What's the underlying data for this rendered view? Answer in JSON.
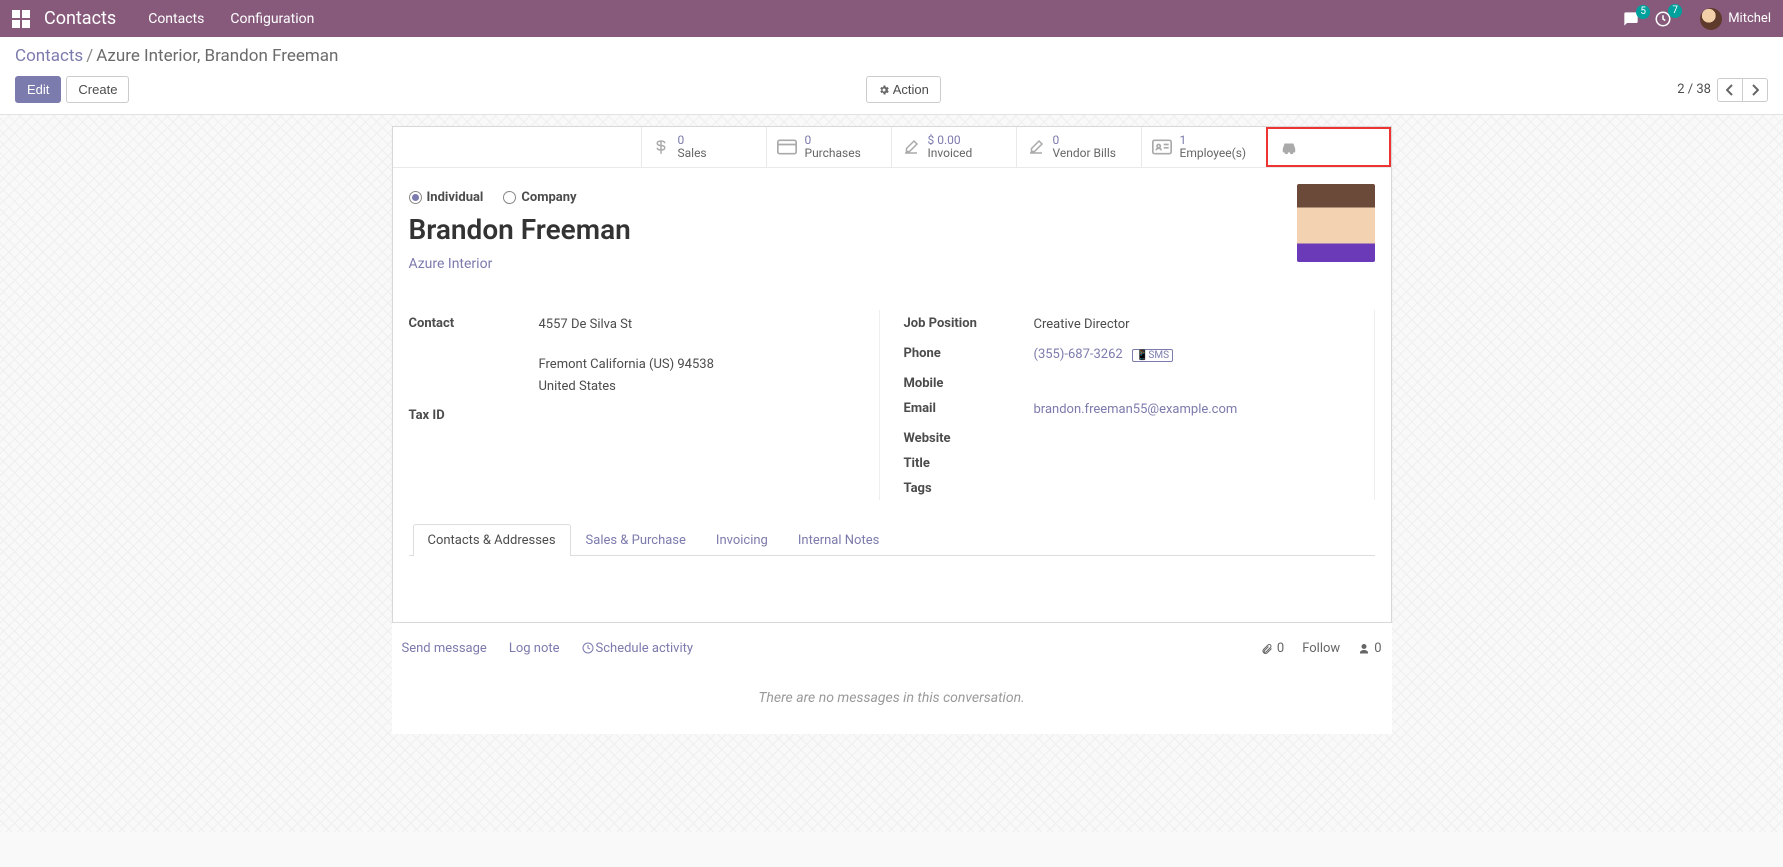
{
  "navbar": {
    "brand": "Contacts",
    "links": [
      "Contacts",
      "Configuration"
    ],
    "chat_badge": "5",
    "activity_badge": "7",
    "user_name": "Mitchel"
  },
  "breadcrumb": {
    "root": "Contacts",
    "active": "Azure Interior, Brandon Freeman"
  },
  "buttons": {
    "edit": "Edit",
    "create": "Create",
    "action": "Action"
  },
  "pager": {
    "current": "2",
    "sep": "/",
    "total": "38"
  },
  "stats": {
    "sales": {
      "value": "0",
      "label": "Sales"
    },
    "purchases": {
      "value": "0",
      "label": "Purchases"
    },
    "invoiced": {
      "value": "$ 0.00",
      "label": "Invoiced"
    },
    "vendor": {
      "value": "0",
      "label": "Vendor Bills"
    },
    "employees": {
      "value": "1",
      "label": "Employee(s)"
    }
  },
  "contact_type": {
    "individual": "Individual",
    "company": "Company"
  },
  "record": {
    "name": "Brandon Freeman",
    "company": "Azure Interior",
    "contact_label": "Contact",
    "street": "4557 De Silva St",
    "city_line": "Fremont  California (US)  94538",
    "country": "United States",
    "tax_id_label": "Tax ID",
    "tax_id": "",
    "job_position_label": "Job Position",
    "job_position": "Creative Director",
    "phone_label": "Phone",
    "phone": "(355)-687-3262",
    "sms_label": "SMS",
    "mobile_label": "Mobile",
    "mobile": "",
    "email_label": "Email",
    "email": "brandon.freeman55@example.com",
    "website_label": "Website",
    "website": "",
    "title_label": "Title",
    "title": "",
    "tags_label": "Tags",
    "tags": ""
  },
  "tabs": {
    "contacts": "Contacts & Addresses",
    "sales": "Sales & Purchase",
    "invoicing": "Invoicing",
    "notes": "Internal Notes"
  },
  "chatter": {
    "send": "Send message",
    "log": "Log note",
    "schedule": "Schedule activity",
    "attachments": "0",
    "follow": "Follow",
    "followers": "0",
    "empty": "There are no messages in this conversation."
  }
}
